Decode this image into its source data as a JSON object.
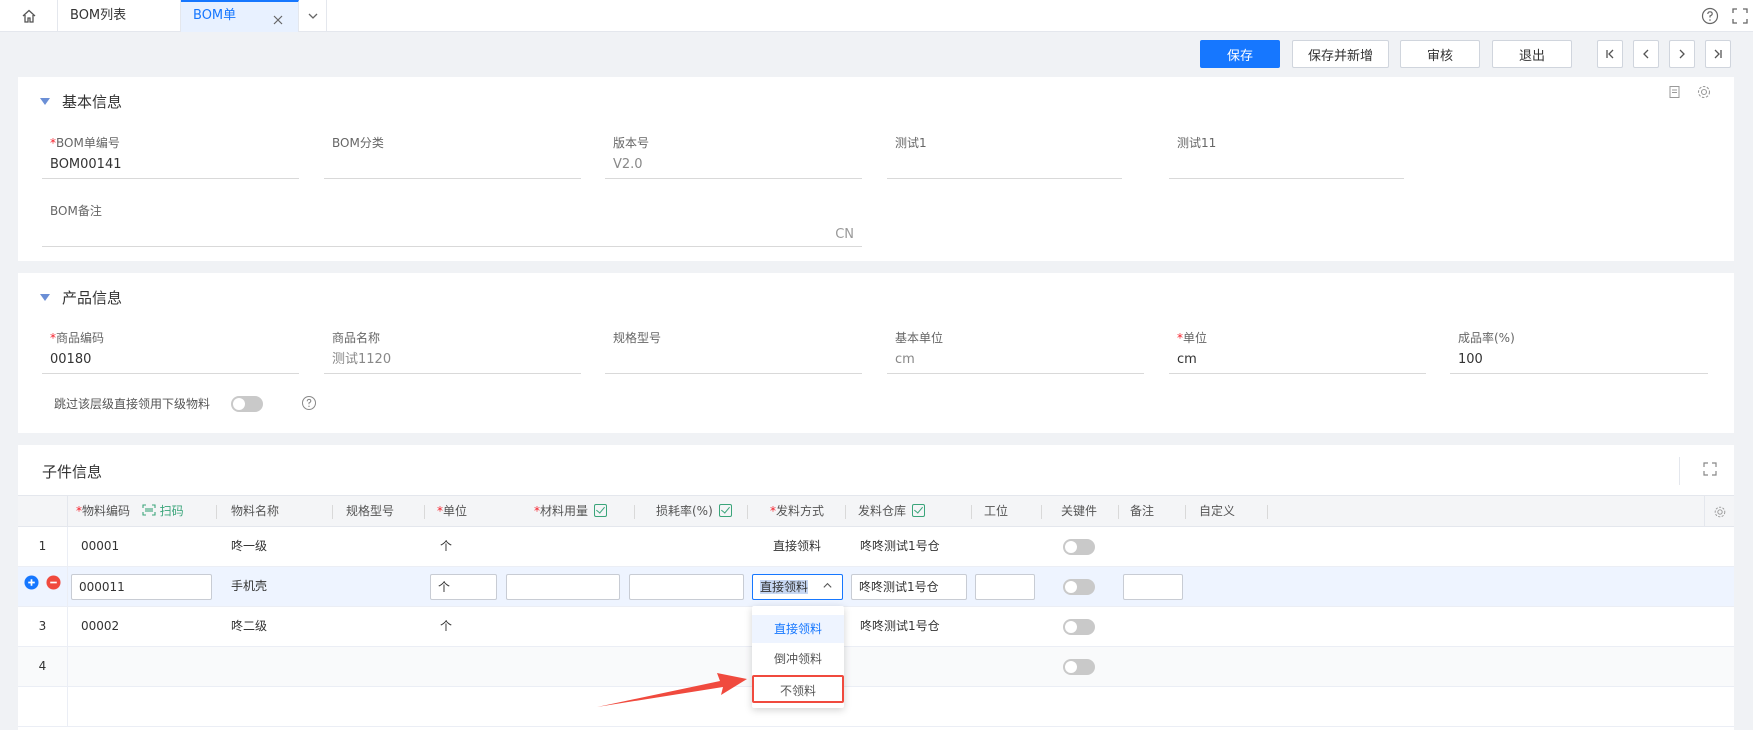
{
  "tabs": [
    {
      "label": "BOM列表"
    },
    {
      "label": "BOM单"
    }
  ],
  "toolbar": {
    "save": "保存",
    "save_new": "保存并新增",
    "audit": "审核",
    "exit": "退出"
  },
  "basic": {
    "title": "基本信息",
    "fields": {
      "bom_no": {
        "label": "BOM单编号",
        "value": "BOM00141"
      },
      "bom_cat": {
        "label": "BOM分类",
        "value": ""
      },
      "version": {
        "label": "版本号",
        "value": "V2.0"
      },
      "test1": {
        "label": "测试1",
        "value": ""
      },
      "test11": {
        "label": "测试11",
        "value": ""
      },
      "remark": {
        "label": "BOM备注",
        "value": "",
        "suffix": "CN"
      }
    }
  },
  "product": {
    "title": "产品信息",
    "fields": {
      "code": {
        "label": "商品编码",
        "value": "00180"
      },
      "name": {
        "label": "商品名称",
        "value": "测试1120"
      },
      "spec": {
        "label": "规格型号",
        "value": ""
      },
      "base_unit": {
        "label": "基本单位",
        "value": "cm"
      },
      "unit": {
        "label": "单位",
        "value": "cm"
      },
      "yield": {
        "label": "成品率(%)",
        "value": "100"
      }
    },
    "skip_label": "跳过该层级直接领用下级物料"
  },
  "children": {
    "title": "子件信息",
    "columns": {
      "code": "物料编码",
      "scan": "扫码",
      "name": "物料名称",
      "spec": "规格型号",
      "unit": "单位",
      "qty": "材料用量",
      "loss": "损耗率(%)",
      "issue": "发料方式",
      "warehouse": "发料仓库",
      "station": "工位",
      "key": "关键件",
      "note": "备注",
      "custom": "自定义"
    },
    "rows": [
      {
        "num": "1",
        "code": "00001",
        "name": "咚一级",
        "unit": "个",
        "issue": "直接领料",
        "warehouse": "咚咚测试1号仓"
      },
      {
        "num": "",
        "code": "000011",
        "name": "手机壳",
        "unit": "个",
        "issue": "直接领料",
        "warehouse": "咚咚测试1号仓"
      },
      {
        "num": "3",
        "code": "00002",
        "name": "咚二级",
        "unit": "个",
        "issue": "",
        "warehouse": "咚咚测试1号仓"
      },
      {
        "num": "4",
        "code": "",
        "name": "",
        "unit": "",
        "issue": "",
        "warehouse": ""
      }
    ],
    "dropdown": [
      "直接领料",
      "倒冲领料",
      "不领料"
    ]
  },
  "colors": {
    "primary": "#1677ff",
    "required": "#f5222d",
    "arrow": "#f04a3e"
  }
}
